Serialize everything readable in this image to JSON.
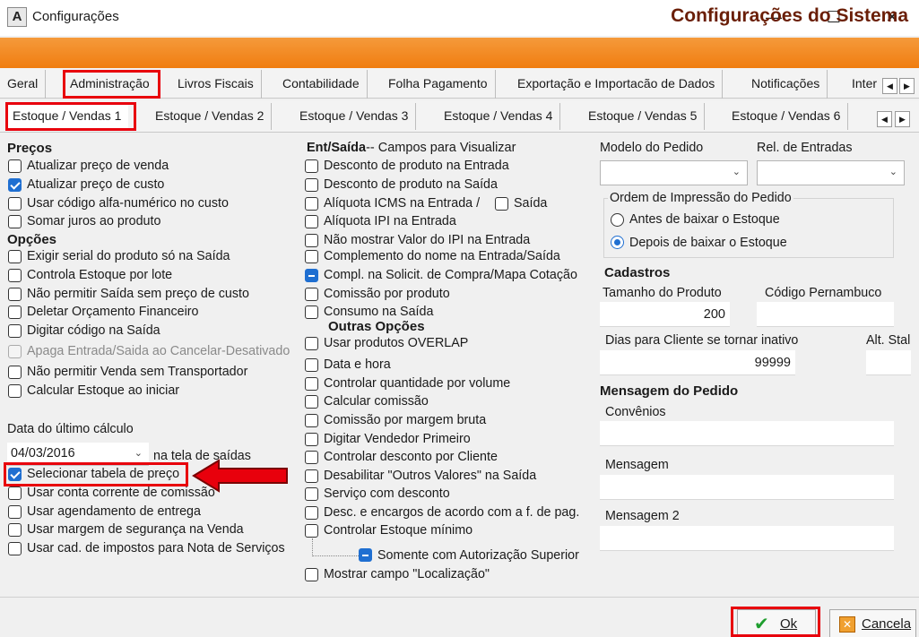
{
  "window": {
    "title": "Configurações",
    "app_icon_letter": "A",
    "minimize": "—",
    "maximize": "☐",
    "close": "✕"
  },
  "banner": {
    "title": "Configurações do Sistema"
  },
  "tabs_main": [
    "Geral",
    "Administração",
    "Livros Fiscais",
    "Contabilidade",
    "Folha Pagamento",
    "Exportação e Importacão de Dados",
    "Notificações",
    "Inter"
  ],
  "tabs_main_selected": "Administração",
  "tabs_sub": [
    "Estoque / Vendas 1",
    "Estoque / Vendas 2",
    "Estoque / Vendas 3",
    "Estoque / Vendas 4",
    "Estoque / Vendas 5",
    "Estoque / Vendas 6"
  ],
  "tabs_sub_selected": "Estoque / Vendas 1",
  "scroll": {
    "left": "◀",
    "right": "▶"
  },
  "col1": {
    "precos_title": "Preços",
    "precos": [
      "Atualizar preço de venda",
      "Atualizar preço de custo",
      "Usar código alfa-numérico no custo",
      "Somar juros ao produto"
    ],
    "opcoes_title": "Opções",
    "opcoes": [
      "Exigir serial  do produto só na Saída",
      "Controla Estoque por lote",
      "Não permitir Saída sem preço de custo",
      "Deletar Orçamento Financeiro",
      "Digitar código na Saída",
      "Apaga Entrada/Saida ao Cancelar-Desativado",
      "Não permitir Venda sem Transportador",
      "Calcular Estoque ao iniciar"
    ],
    "data_label": "Data do último cálculo",
    "data_value": "04/03/2016",
    "data_suffix": "na tela de saídas",
    "rest": [
      "Selecionar tabela de preço",
      "Usar conta corrente de comissão",
      "Usar agendamento de entrega",
      "Usar margem de segurança na Venda",
      "Usar cad. de impostos para Nota de Serviços"
    ]
  },
  "col2": {
    "title_bold": "Ent/Saída",
    "title_rest": "-- Campos para Visualizar",
    "items": [
      "Desconto de produto na Entrada",
      "Desconto de produto na Saída",
      "Alíquota ICMS na Entrada /",
      "Alíquota IPI na Entrada",
      "Não mostrar Valor do IPI na Entrada",
      "Complemento do nome na Entrada/Saída",
      "Compl. na Solicit. de Compra/Mapa Cotação",
      "Comissão por produto",
      "Consumo na Saída"
    ],
    "icms_saida": "Saída",
    "outras_title": "Outras Opções",
    "outras": [
      "Usar produtos OVERLAP",
      "Data e hora",
      "Controlar quantidade por volume",
      "Calcular comissão",
      "Comissão por margem bruta",
      "Digitar Vendedor Primeiro",
      "Controlar desconto por Cliente",
      "Desabilitar \"Outros Valores\" na Saída",
      "Serviço com desconto",
      "Desc. e encargos de acordo com a f. de pag.",
      "Controlar Estoque mínimo"
    ],
    "sub_item": "Somente com Autorização Superior",
    "last_item": "Mostrar campo \"Localização\""
  },
  "col3": {
    "modelo_label": "Modelo do Pedido",
    "rel_label": "Rel. de Entradas",
    "ordem_title": "Ordem de Impressão do Pedido",
    "ordem_options": [
      "Antes de baixar o Estoque",
      "Depois de baixar o Estoque"
    ],
    "ordem_selected": "Depois de baixar o Estoque",
    "cadastros_title": "Cadastros",
    "tamanho_label": "Tamanho do Produto",
    "tamanho_value": "200",
    "codigo_pe_label": "Código Pernambuco",
    "codigo_pe_value": "",
    "dias_label": "Dias para Cliente se tornar inativo",
    "dias_value": "99999",
    "alt_label": "Alt. Stal",
    "mensagem_title": "Mensagem do Pedido",
    "convenios_label": "Convênios",
    "mensagem_label": "Mensagem",
    "mensagem2_label": "Mensagem 2"
  },
  "footer": {
    "ok_label": "Ok",
    "cancel_label": "Cancela"
  },
  "colors": {
    "banner": "#f07d10",
    "banner_text": "#6a1e06",
    "highlight": "#e8000c",
    "check": "#1f6fd1",
    "ok_check": "#1e9e2e"
  }
}
